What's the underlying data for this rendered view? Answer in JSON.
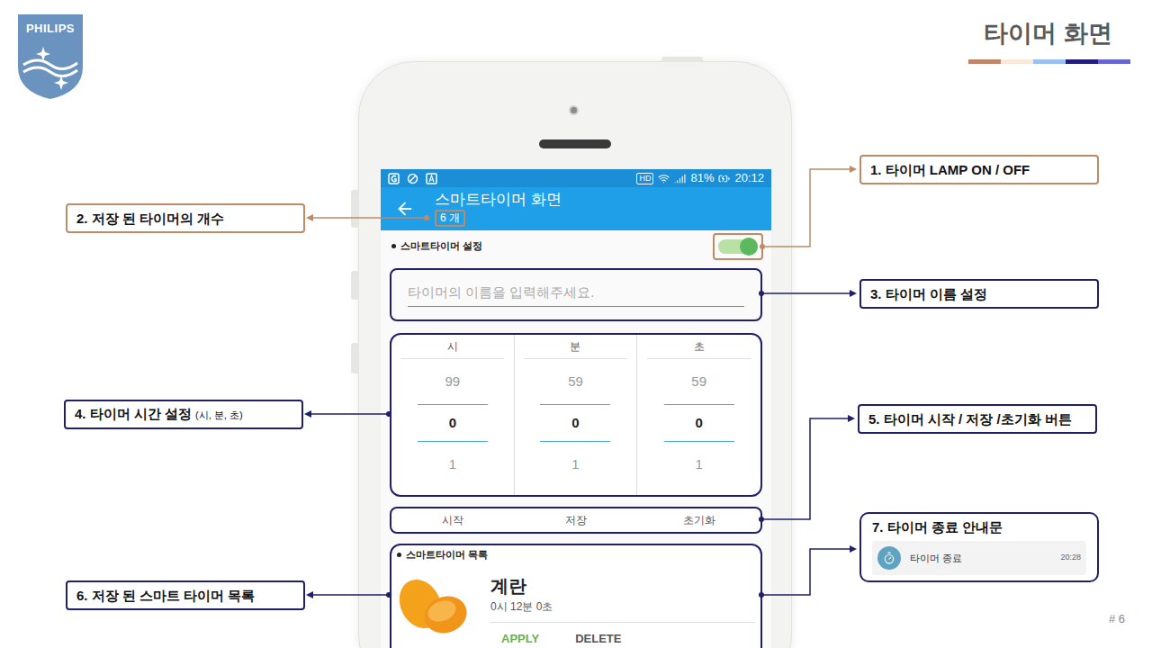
{
  "slide": {
    "logo": "PHILIPS",
    "title": "타이머 화면",
    "page": "# 6"
  },
  "phone": {
    "status_bar": {
      "badge": "HD",
      "battery": "81%",
      "time": "20:12"
    },
    "app_bar": {
      "title": "스마트타이머 화면",
      "count": "6 개"
    },
    "settings": {
      "header": "스마트타이머 설정",
      "lamp_on": true,
      "name_placeholder": "타이머의 이름을 입력해주세요."
    },
    "picker": {
      "columns": [
        {
          "label": "시",
          "above": "99",
          "value": "0",
          "below": "1"
        },
        {
          "label": "분",
          "above": "59",
          "value": "0",
          "below": "1"
        },
        {
          "label": "초",
          "above": "59",
          "value": "0",
          "below": "1"
        }
      ]
    },
    "buttons": [
      "시작",
      "저장",
      "초기화"
    ],
    "timer_list": {
      "header": "스마트타이머 목록",
      "items": [
        {
          "name": "계란",
          "duration": "0시 12분 0초",
          "actions": [
            {
              "label": "APPLY",
              "color": "#6ab04c"
            },
            {
              "label": "DELETE",
              "color": "#555555"
            }
          ]
        }
      ]
    }
  },
  "callouts": [
    {
      "kind": "label",
      "label": "1. 타이머 LAMP ON / OFF",
      "color": "#c08a65"
    },
    {
      "kind": "label",
      "label": "2. 저장 된 타이머의 개수",
      "color": "#c08a65"
    },
    {
      "kind": "label",
      "label": "3. 타이머 이름 설정",
      "color": "#1f1f6b"
    },
    {
      "kind": "label",
      "label": "4. 타이머 시간 설정",
      "note": "(시, 분, 초)",
      "color": "#1f1f6b"
    },
    {
      "kind": "label",
      "label": "5. 타이머 시작 / 저장 /초기화 버튼",
      "color": "#1f1f6b"
    },
    {
      "kind": "label",
      "label": "6. 저장 된 스마트 타이머 목록",
      "color": "#1f1f6b"
    },
    {
      "kind": "notification",
      "label": "7. 타이머 종료 안내문",
      "color": "#1f1f6b",
      "notification": {
        "text": "타이머 종료",
        "time": "20:28"
      }
    }
  ]
}
